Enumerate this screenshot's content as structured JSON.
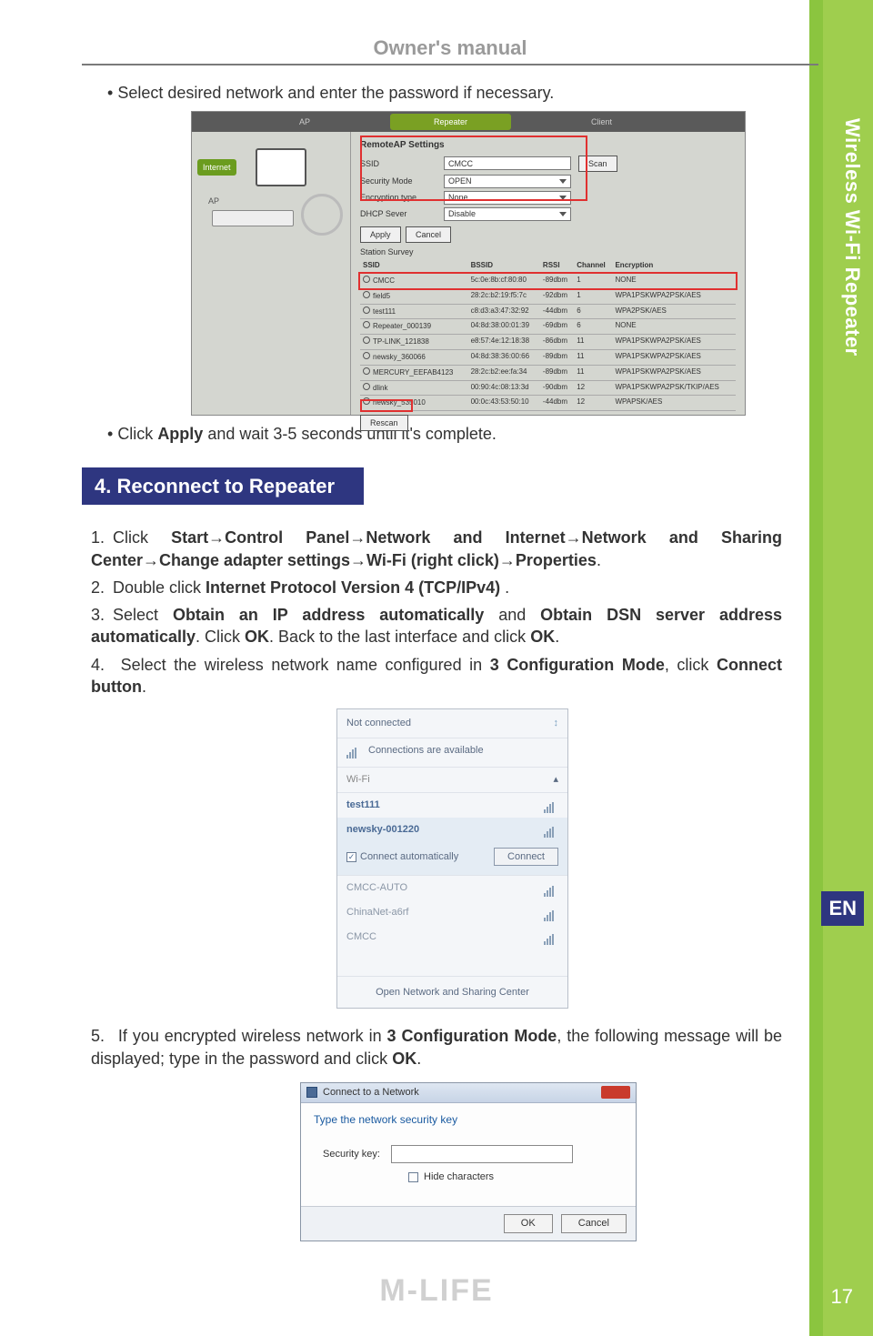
{
  "header": {
    "title": "Owner's manual"
  },
  "sidebar": {
    "vertical_label": "Wireless Wi-Fi Repeater",
    "lang": "EN",
    "page": "17",
    "brand": "M-LIFE"
  },
  "bullets": {
    "b1": "Select desired network and enter the password if necessary.",
    "b2_pre": "Click ",
    "b2_bold": "Apply",
    "b2_post": " and wait 3-5 seconds until it's complete."
  },
  "section4": {
    "title": "4. Reconnect to Repeater"
  },
  "steps": {
    "s1a": "Click ",
    "s1b": "Start→Control Panel→Network and Internet→Network and Sharing Center→Change adapter settings→Wi-Fi (right click)→Properties",
    "s1c": ".",
    "s2a": "Double click ",
    "s2b": "Internet Protocol Version 4 (TCP/IPv4)",
    "s2c": " .",
    "s3a": "Select ",
    "s3b": "Obtain an IP address automatically",
    "s3c": " and ",
    "s3d": "Obtain DSN server address automatically",
    "s3e": ". Click ",
    "s3f": "OK",
    "s3g": ". Back to the last interface and click ",
    "s3h": "OK",
    "s3i": ".",
    "s4a": " Select the wireless network name configured in ",
    "s4b": "3 Configuration Mode",
    "s4c": ", click ",
    "s4d": "Connect button",
    "s4e": ".",
    "s5a": " If you encrypted wireless network in ",
    "s5b": "3 Configuration Mode",
    "s5c": ", the following message will be displayed; type in the password and click ",
    "s5d": "OK",
    "s5e": "."
  },
  "shot1": {
    "tabs": {
      "ap": "AP",
      "repeater": "Repeater",
      "client": "Client"
    },
    "diagram": {
      "internet": "Internet",
      "ap": "AP"
    },
    "form_title": "RemoteAP Settings",
    "fields": {
      "ssid_label": "SSID",
      "ssid_value": "CMCC",
      "sec_label": "Security Mode",
      "sec_value": "OPEN",
      "enc_label": "Encryption type",
      "enc_value": "None",
      "dhcp_label": "DHCP Sever",
      "dhcp_value": "Disable"
    },
    "buttons": {
      "apply": "Apply",
      "cancel": "Cancel",
      "scan": "Scan",
      "rescan": "Rescan"
    },
    "survey_title": "Station Survey",
    "cols": {
      "ssid": "SSID",
      "bssid": "BSSID",
      "rssi": "RSSI",
      "chan": "Channel",
      "enc": "Encryption"
    },
    "rows": [
      {
        "ssid": "CMCC",
        "bssid": "5c:0e:8b:cf:80:80",
        "rssi": "-89dbm",
        "chan": "1",
        "enc": "NONE"
      },
      {
        "ssid": "field5",
        "bssid": "28:2c:b2:19:f5:7c",
        "rssi": "-92dbm",
        "chan": "1",
        "enc": "WPA1PSKWPA2PSK/AES"
      },
      {
        "ssid": "test111",
        "bssid": "c8:d3:a3:47:32:92",
        "rssi": "-44dbm",
        "chan": "6",
        "enc": "WPA2PSK/AES"
      },
      {
        "ssid": "Repeater_000139",
        "bssid": "04:8d:38:00:01:39",
        "rssi": "-69dbm",
        "chan": "6",
        "enc": "NONE"
      },
      {
        "ssid": "TP-LINK_121838",
        "bssid": "e8:57:4e:12:18:38",
        "rssi": "-86dbm",
        "chan": "11",
        "enc": "WPA1PSKWPA2PSK/AES"
      },
      {
        "ssid": "newsky_360066",
        "bssid": "04:8d:38:36:00:66",
        "rssi": "-89dbm",
        "chan": "11",
        "enc": "WPA1PSKWPA2PSK/AES"
      },
      {
        "ssid": "MERCURY_EEFAB4123",
        "bssid": "28:2c:b2:ee:fa:34",
        "rssi": "-89dbm",
        "chan": "11",
        "enc": "WPA1PSKWPA2PSK/AES"
      },
      {
        "ssid": "dlink",
        "bssid": "00:90:4c:08:13:3d",
        "rssi": "-90dbm",
        "chan": "12",
        "enc": "WPA1PSKWPA2PSK/TKIP/AES"
      },
      {
        "ssid": "newsky_535010",
        "bssid": "00:0c:43:53:50:10",
        "rssi": "-44dbm",
        "chan": "12",
        "enc": "WPAPSK/AES"
      }
    ]
  },
  "shot2": {
    "not_connected": "Not connected",
    "avail": "Connections are available",
    "wifi": "Wi-Fi",
    "nets": [
      {
        "name": "test111"
      },
      {
        "name": "newsky-001220"
      }
    ],
    "connect_auto": "Connect automatically",
    "connect_btn": "Connect",
    "more": [
      {
        "name": "CMCC-AUTO"
      },
      {
        "name": "ChinaNet-a6rf"
      },
      {
        "name": "CMCC"
      }
    ],
    "footer": "Open Network and Sharing Center"
  },
  "shot3": {
    "title": "Connect to a Network",
    "msg": "Type the network security key",
    "sec_label": "Security key:",
    "hide": "Hide characters",
    "ok": "OK",
    "cancel": "Cancel"
  }
}
